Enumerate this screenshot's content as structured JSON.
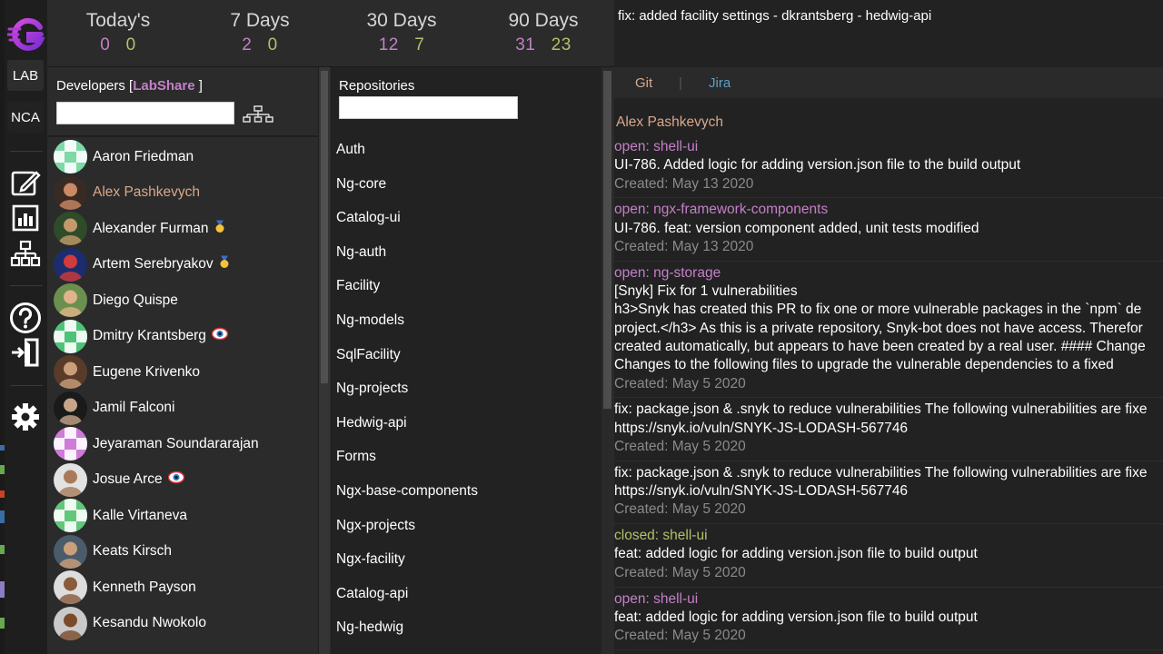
{
  "rail": {
    "logo_letter": "G",
    "lab_label": "LAB",
    "nca_label": "NCA"
  },
  "stats": [
    {
      "label": "Today's",
      "open": "0",
      "closed": "0"
    },
    {
      "label": "7 Days",
      "open": "2",
      "closed": "0"
    },
    {
      "label": "30 Days",
      "open": "12",
      "closed": "7"
    },
    {
      "label": "90 Days",
      "open": "31",
      "closed": "23"
    }
  ],
  "developers": {
    "title": "Developers",
    "bracket_open": "[",
    "bracket_close": "]",
    "lab_link": "LabShare",
    "search_value": "",
    "items": [
      {
        "name": "Aaron Friedman",
        "badge": ""
      },
      {
        "name": "Alex Pashkevych",
        "badge": "",
        "selected": true
      },
      {
        "name": "Alexander Furman",
        "badge": "medal"
      },
      {
        "name": "Artem Serebryakov",
        "badge": "medal"
      },
      {
        "name": "Diego Quispe",
        "badge": ""
      },
      {
        "name": "Dmitry Krantsberg",
        "badge": "eye"
      },
      {
        "name": "Eugene Krivenko",
        "badge": ""
      },
      {
        "name": "Jamil Falconi",
        "badge": ""
      },
      {
        "name": "Jeyaraman Soundararajan",
        "badge": ""
      },
      {
        "name": "Josue Arce",
        "badge": "eye"
      },
      {
        "name": "Kalle Virtaneva",
        "badge": ""
      },
      {
        "name": "Keats Kirsch",
        "badge": ""
      },
      {
        "name": "Kenneth Payson",
        "badge": ""
      },
      {
        "name": "Kesandu Nwokolo",
        "badge": ""
      }
    ]
  },
  "repositories": {
    "title": "Repositories",
    "search_value": "",
    "items": [
      "Auth",
      "Ng-core",
      "Catalog-ui",
      "Ng-auth",
      "Facility",
      "Ng-models",
      "SqlFacility",
      "Ng-projects",
      "Hedwig-api",
      "Forms",
      "Ngx-base-components",
      "Ngx-projects",
      "Ngx-facility",
      "Catalog-api",
      "Ng-hedwig"
    ]
  },
  "detail": {
    "title": "fix: added facility settings - dkrantsberg - hedwig-api",
    "tabs": {
      "git": "Git",
      "separator": "|",
      "jira": "Jira"
    },
    "author": "Alex Pashkevych",
    "entries": [
      {
        "status": "open: shell-ui",
        "state": "open",
        "lines": [
          "UI-786. Added logic for adding version.json file to the build output"
        ],
        "created": "Created: May 13 2020"
      },
      {
        "status": "open: ngx-framework-components",
        "state": "open",
        "lines": [
          "UI-786. feat: version component added, unit tests modified"
        ],
        "created": "Created: May 13 2020"
      },
      {
        "status": "open: ng-storage",
        "state": "open",
        "lines": [
          "[Snyk] Fix for 1 vulnerabilities",
          "h3>Snyk has created this PR to fix one or more vulnerable packages in the `npm` de",
          "project.</h3> As this is a private repository, Snyk-bot does not have access. Therefor",
          "created automatically, but appears to have been created by a real user. #### Change",
          "Changes to the following files to upgrade the vulnerable dependencies to a fixed"
        ],
        "created": "Created: May 5 2020"
      },
      {
        "status": "",
        "state": "none",
        "lines": [
          "fix: package.json & .snyk to reduce vulnerabilities The following vulnerabilities are fixe",
          "https://snyk.io/vuln/SNYK-JS-LODASH-567746"
        ],
        "created": "Created: May 5 2020"
      },
      {
        "status": "",
        "state": "none",
        "lines": [
          "fix: package.json & .snyk to reduce vulnerabilities The following vulnerabilities are fixe",
          "https://snyk.io/vuln/SNYK-JS-LODASH-567746"
        ],
        "created": "Created: May 5 2020"
      },
      {
        "status": "closed: shell-ui",
        "state": "closed",
        "lines": [
          "feat: added logic for adding version.json file to build output"
        ],
        "created": "Created: May 5 2020"
      },
      {
        "status": "open: shell-ui",
        "state": "open",
        "lines": [
          "feat: added logic for adding version.json file to build output"
        ],
        "created": "Created: May 5 2020"
      }
    ]
  },
  "colors": {
    "open": "#c380c8",
    "closed": "#b3c06a",
    "selected": "#d9a88a",
    "jira": "#5b9fc8"
  }
}
